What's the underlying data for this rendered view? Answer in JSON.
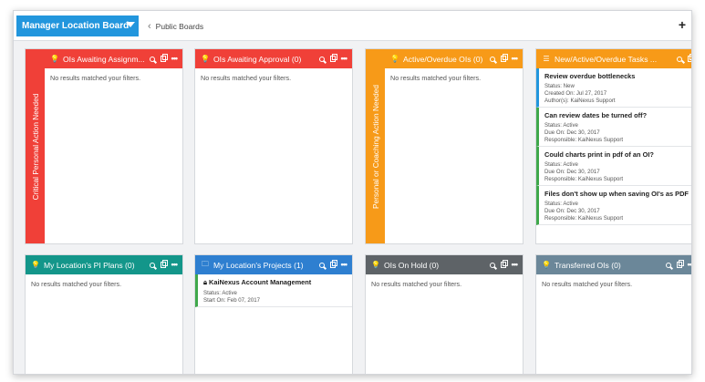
{
  "topbar": {
    "board_name": "Manager Location Board",
    "breadcrumb": "Public Boards",
    "add_label": "+"
  },
  "colors": {
    "red": "#f04038",
    "orange": "#f79a18",
    "teal": "#13968a",
    "blue": "#2e7fd0",
    "gray": "#5e6367",
    "slate": "#6b8799",
    "accent": "#2296dd"
  },
  "side_labels": {
    "critical": "Critical Personal Action Needed",
    "coaching": "Personal or Coaching Action Needed"
  },
  "panels": {
    "ois_awaiting_assignment": {
      "title": "OIs Awaiting Assignm...",
      "empty": "No results matched your filters."
    },
    "ois_awaiting_approval": {
      "title": "OIs Awaiting Approval (0)",
      "empty": "No results matched your filters."
    },
    "active_overdue": {
      "title": "Active/Overdue OIs (0)",
      "empty": "No results matched your filters."
    },
    "tasks": {
      "title": "New/Active/Overdue Tasks ...",
      "items": [
        {
          "title": "Review overdue bottlenecks",
          "line1": "Status: New",
          "line2": "Created On: Jul 27, 2017",
          "line3": "Author(s): KaiNexus Support"
        },
        {
          "title": "Can review dates be turned off?",
          "line1": "Status: Active",
          "line2": "Due On: Dec 30, 2017",
          "line3": "Responsible: KaiNexus Support"
        },
        {
          "title": "Could charts print in pdf of an OI?",
          "line1": "Status: Active",
          "line2": "Due On: Dec 30, 2017",
          "line3": "Responsible: KaiNexus Support"
        },
        {
          "title": "Files don't show up when saving OI's as PDF",
          "line1": "Status: Active",
          "line2": "Due On: Dec 30, 2017",
          "line3": "Responsible: KaiNexus Support"
        }
      ]
    },
    "pi_plans": {
      "title": "My Location's PI Plans (0)",
      "empty": "No results matched your filters."
    },
    "projects": {
      "title": "My Location's Projects (1)",
      "item": {
        "title": "KaiNexus Account Management",
        "line1": "Status: Active",
        "line2": "Start On: Feb 07, 2017"
      }
    },
    "on_hold": {
      "title": "OIs On Hold (0)",
      "empty": "No results matched your filters."
    },
    "transferred": {
      "title": "Transferred OIs (0)",
      "empty": "No results matched your filters."
    }
  }
}
